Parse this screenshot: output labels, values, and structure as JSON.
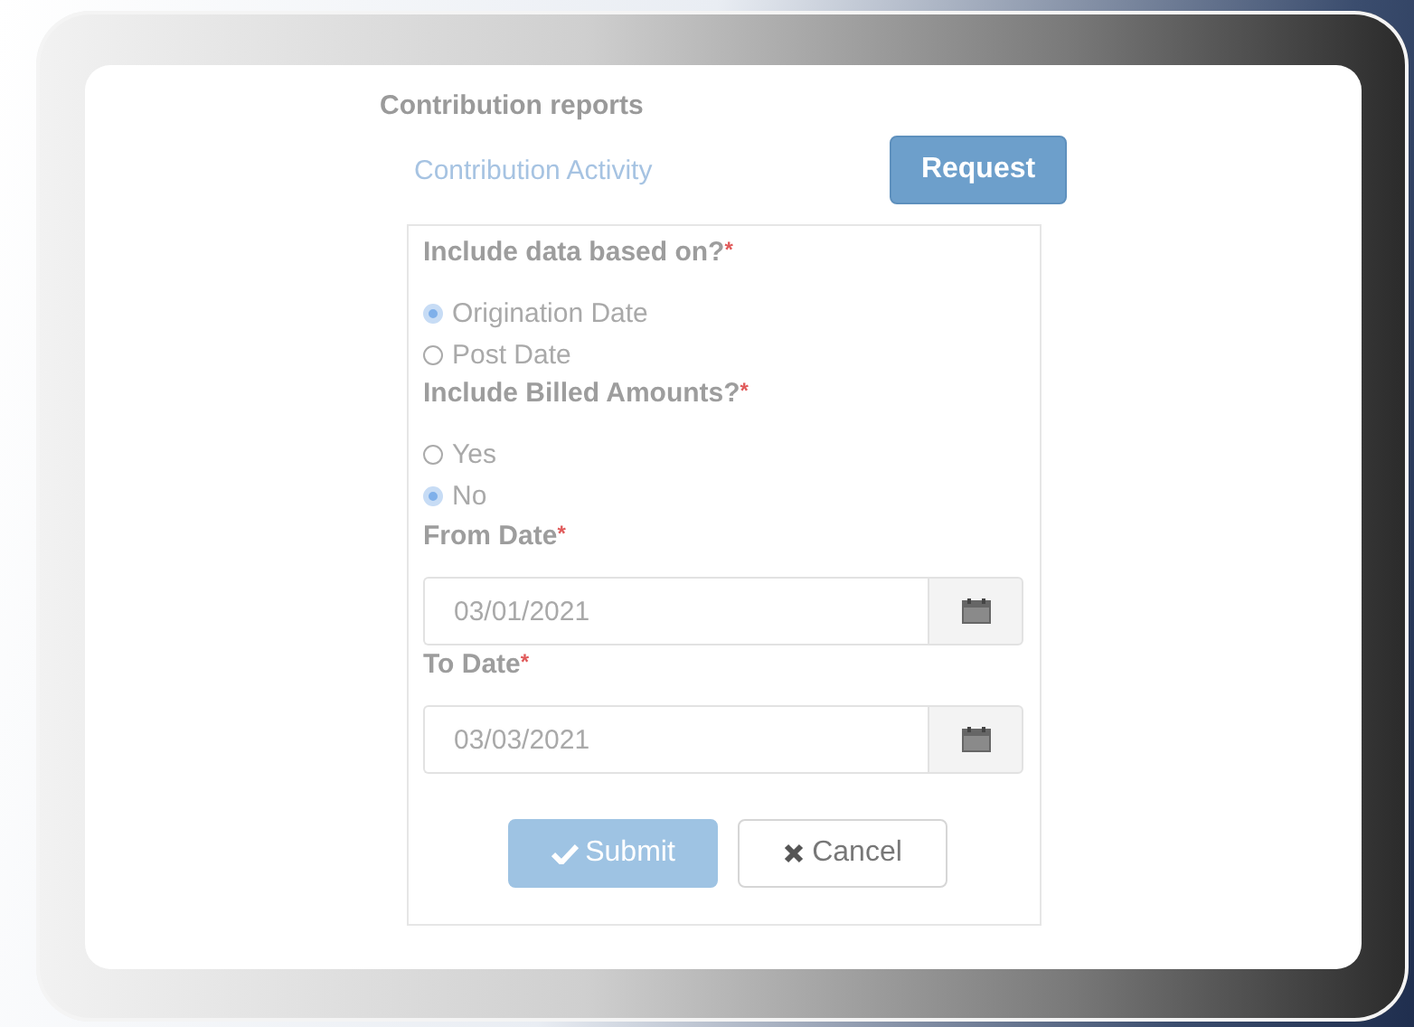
{
  "page_title": "Contribution reports",
  "report_link": "Contribution Activity",
  "request_button": "Request",
  "questions": [
    {
      "label": "Include data based on?",
      "required_mark": "*",
      "options": [
        {
          "label": "Origination Date",
          "selected": true
        },
        {
          "label": "Post Date",
          "selected": false
        }
      ]
    },
    {
      "label": "Include Billed Amounts?",
      "required_mark": "*",
      "options": [
        {
          "label": "Yes",
          "selected": false
        },
        {
          "label": "No",
          "selected": true
        }
      ]
    }
  ],
  "date_fields": [
    {
      "label": "From Date",
      "required_mark": "*",
      "value": "03/01/2021"
    },
    {
      "label": "To Date",
      "required_mark": "*",
      "value": "03/03/2021"
    }
  ],
  "buttons": [
    {
      "kind": "submit",
      "label": "Submit",
      "disabled": true
    },
    {
      "kind": "cancel",
      "label": "Cancel",
      "disabled": false
    }
  ]
}
